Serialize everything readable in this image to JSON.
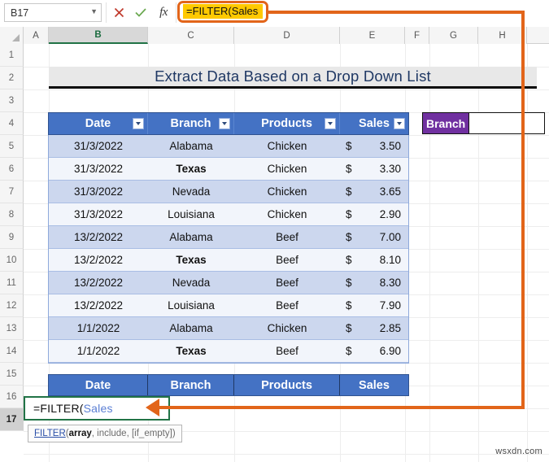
{
  "app": {
    "name_box_value": "B17",
    "name_box_chevron": "chevron-down-icon",
    "cancel_icon": "cancel-x-icon",
    "enter_icon": "enter-check-icon",
    "function_icon": "fx-insert-function-icon",
    "formula_bar_value": "=FILTER(Sales",
    "watermark": "wsxdn.com"
  },
  "columns": [
    "A",
    "B",
    "C",
    "D",
    "E",
    "F",
    "G",
    "H"
  ],
  "selected_column": "B",
  "rows": [
    "1",
    "2",
    "3",
    "4",
    "5",
    "6",
    "7",
    "8",
    "9",
    "10",
    "11",
    "12",
    "13",
    "14",
    "15",
    "16",
    "17"
  ],
  "selected_row": "17",
  "title": "Extract Data Based on a Drop Down List",
  "table": {
    "headers": [
      "Date",
      "Branch",
      "Products",
      "Sales"
    ],
    "filter_icon": "filter-dropdown-icon",
    "currency_symbol": "$",
    "rows": [
      {
        "date": "31/3/2022",
        "branch": "Alabama",
        "bold": false,
        "product": "Chicken",
        "sales": "3.50"
      },
      {
        "date": "31/3/2022",
        "branch": "Texas",
        "bold": true,
        "product": "Chicken",
        "sales": "3.30"
      },
      {
        "date": "31/3/2022",
        "branch": "Nevada",
        "bold": false,
        "product": "Chicken",
        "sales": "3.65"
      },
      {
        "date": "31/3/2022",
        "branch": "Louisiana",
        "bold": false,
        "product": "Chicken",
        "sales": "2.90"
      },
      {
        "date": "13/2/2022",
        "branch": "Alabama",
        "bold": false,
        "product": "Beef",
        "sales": "7.00"
      },
      {
        "date": "13/2/2022",
        "branch": "Texas",
        "bold": true,
        "product": "Beef",
        "sales": "8.10"
      },
      {
        "date": "13/2/2022",
        "branch": "Nevada",
        "bold": false,
        "product": "Beef",
        "sales": "8.30"
      },
      {
        "date": "13/2/2022",
        "branch": "Louisiana",
        "bold": false,
        "product": "Beef",
        "sales": "7.90"
      },
      {
        "date": "1/1/2022",
        "branch": "Alabama",
        "bold": false,
        "product": "Chicken",
        "sales": "2.85"
      },
      {
        "date": "1/1/2022",
        "branch": "Texas",
        "bold": true,
        "product": "Beef",
        "sales": "6.90"
      }
    ]
  },
  "branch_selector": {
    "label": "Branch",
    "value": "",
    "label_color": "#7030a0"
  },
  "output": {
    "headers": [
      "Date",
      "Branch",
      "Products",
      "Sales"
    ],
    "formula_prefix": "=FILTER(",
    "formula_argument": "Sales"
  },
  "tooltip": {
    "function_name": "FILTER",
    "open_paren": " (",
    "arg_active": "array",
    "args_rest": ", include, [if_empty])"
  },
  "colors": {
    "table_header_blue": "#4472c4",
    "band_blue": "#ccd7ee",
    "row_white": "#f2f5fb",
    "annotation_orange": "#e2651a",
    "highlight_yellow": "#ffc900",
    "active_cell_green": "#217346",
    "title_navy": "#1f3864"
  }
}
